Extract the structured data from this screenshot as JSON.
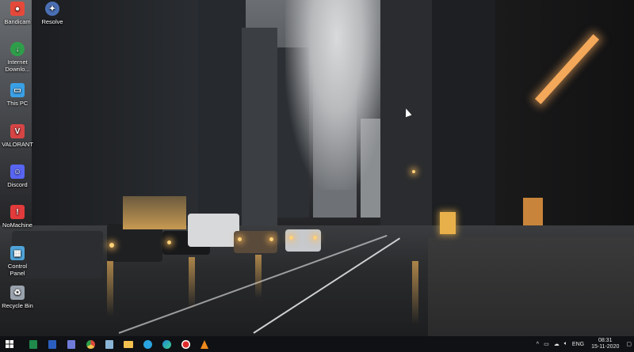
{
  "desktop": {
    "icons": [
      {
        "label": "Bandicam",
        "icon": "bandicam-icon",
        "color": "#e5493a"
      },
      {
        "label": "Resolve",
        "icon": "resolve-icon",
        "color": "#4a6fb5"
      },
      {
        "label": "Internet Downlo...",
        "icon": "idm-icon",
        "color": "#2f9e4a"
      },
      {
        "label": "This PC",
        "icon": "this-pc-icon",
        "color": "#3aa0e6"
      },
      {
        "label": "VALORANT",
        "icon": "valorant-icon",
        "color": "#d64545"
      },
      {
        "label": "Discord",
        "icon": "discord-icon",
        "color": "#5865f2"
      },
      {
        "label": "NoMachine",
        "icon": "nomachine-icon",
        "color": "#e23b3b"
      },
      {
        "label": "Control Panel",
        "icon": "control-panel-icon",
        "color": "#4fa3d8"
      },
      {
        "label": "Recycle Bin",
        "icon": "recycle-bin-icon",
        "color": "#9aa3ad"
      }
    ]
  },
  "taskbar": {
    "start_icon": "windows-start-icon",
    "pinned": [
      {
        "icon": "excel-icon",
        "color": "#1f8a4c"
      },
      {
        "icon": "word-icon",
        "color": "#2b5fbf"
      },
      {
        "icon": "calculator-icon",
        "color": "#6f7bd9"
      },
      {
        "icon": "chrome-icon",
        "color": "#d9463b"
      },
      {
        "icon": "notepad-icon",
        "color": "#8ab4d6"
      },
      {
        "icon": "file-explorer-icon",
        "color": "#f2c14e"
      },
      {
        "icon": "telegram-icon",
        "color": "#2aa3e0"
      },
      {
        "icon": "edge-icon",
        "color": "#1f8ad6"
      },
      {
        "icon": "record-icon",
        "color": "#e02a2a"
      },
      {
        "icon": "vlc-icon",
        "color": "#f08a1c"
      }
    ],
    "tray": {
      "language": "ENG",
      "time": "08:31",
      "date": "15-11-2020"
    }
  }
}
